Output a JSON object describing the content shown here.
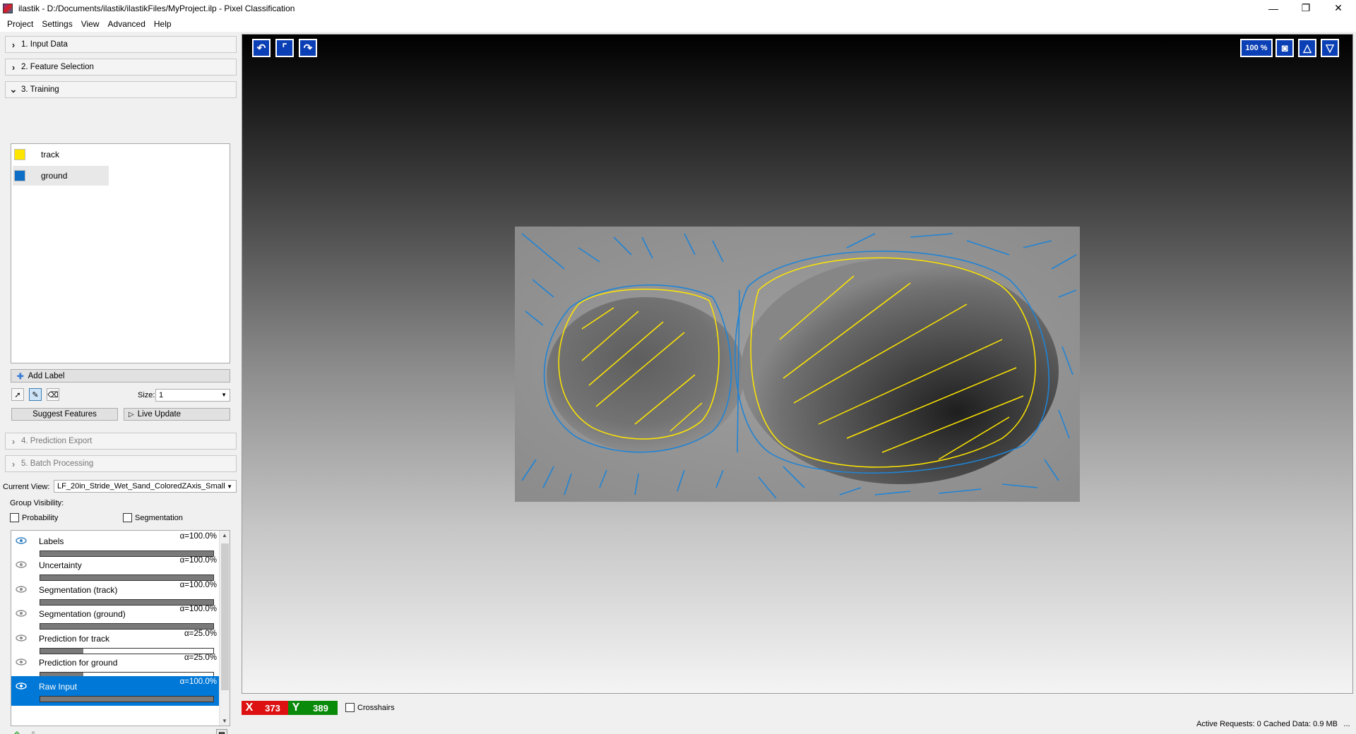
{
  "window": {
    "title": "ilastik - D:/Documents/ilastik/ilastikFiles/MyProject.ilp - Pixel Classification",
    "minimize": "—",
    "restore": "❐",
    "close": "✕"
  },
  "menu": [
    "Project",
    "Settings",
    "View",
    "Advanced",
    "Help"
  ],
  "applets": {
    "input_data": "1. Input Data",
    "feature_selection": "2. Feature Selection",
    "training": "3. Training",
    "prediction_export": "4. Prediction Export",
    "batch_processing": "5. Batch Processing"
  },
  "labels": [
    {
      "name": "track",
      "color": "#ffe600"
    },
    {
      "name": "ground",
      "color": "#0f6fc6"
    }
  ],
  "training": {
    "add_label": "Add Label",
    "size_label": "Size:",
    "size_value": "1",
    "suggest_features": "Suggest Features",
    "live_update": "Live Update"
  },
  "current_view": {
    "label": "Current View:",
    "value": "LF_20in_Stride_Wet_Sand_ColoredZAxis_Small"
  },
  "group_visibility": {
    "label": "Group Visibility:",
    "probability": "Probability",
    "segmentation": "Segmentation"
  },
  "layers": [
    {
      "name": "Labels",
      "opacity": "α=100.0%",
      "level": 1.0
    },
    {
      "name": "Uncertainty",
      "opacity": "α=100.0%",
      "level": 1.0
    },
    {
      "name": "Segmentation (track)",
      "opacity": "α=100.0%",
      "level": 1.0
    },
    {
      "name": "Segmentation (ground)",
      "opacity": "α=100.0%",
      "level": 1.0
    },
    {
      "name": "Prediction for track",
      "opacity": "α=25.0%",
      "level": 0.25
    },
    {
      "name": "Prediction for ground",
      "opacity": "α=25.0%",
      "level": 0.25
    },
    {
      "name": "Raw Input",
      "opacity": "α=100.0%",
      "level": 1.0
    }
  ],
  "viewer": {
    "zoom": "100 %",
    "accent": "#0b3fb5"
  },
  "coords": {
    "x_axis": "X",
    "x_value": "373",
    "y_axis": "Y",
    "y_value": "389",
    "crosshairs": "Crosshairs"
  },
  "status": {
    "text": "Active Requests: 0  Cached Data: 0.9 MB",
    "more": "..."
  }
}
